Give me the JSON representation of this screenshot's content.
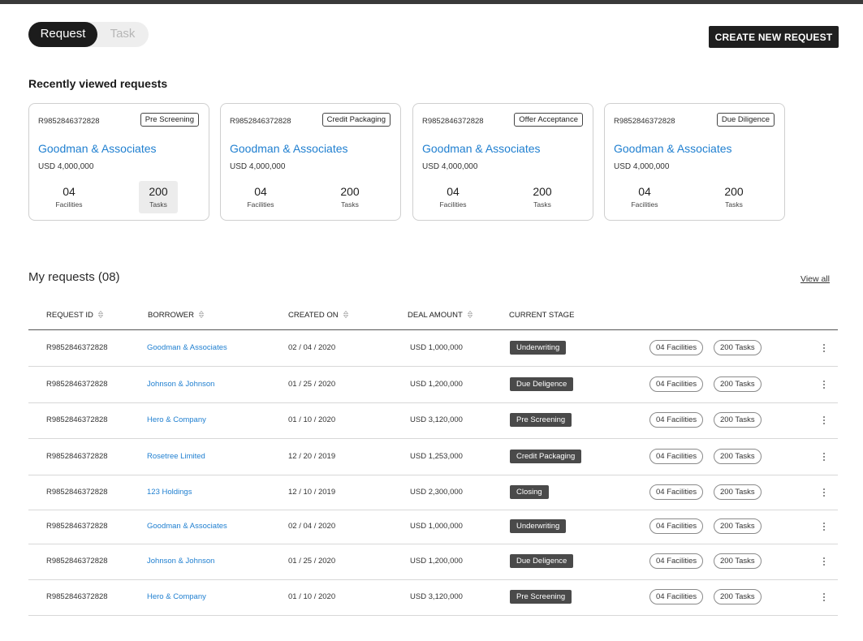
{
  "toggle": {
    "active": "Request",
    "inactive": "Task"
  },
  "create_button": "CREATE NEW REQUEST",
  "recent": {
    "title": "Recently viewed  requests",
    "cards": [
      {
        "id": "R9852846372828",
        "stage": "Pre Screening",
        "name": "Goodman & Associates",
        "amount": "USD 4,000,000",
        "facilities": "04",
        "facilities_label": "Facilities",
        "tasks": "200",
        "tasks_label": "Tasks"
      },
      {
        "id": "R9852846372828",
        "stage": "Credit Packaging",
        "name": "Goodman & Associates",
        "amount": "USD 4,000,000",
        "facilities": "04",
        "facilities_label": "Facilities",
        "tasks": "200",
        "tasks_label": "Tasks"
      },
      {
        "id": "R9852846372828",
        "stage": "Offer Acceptance",
        "name": "Goodman & Associates",
        "amount": "USD 4,000,000",
        "facilities": "04",
        "facilities_label": "Facilities",
        "tasks": "200",
        "tasks_label": "Tasks"
      },
      {
        "id": "R9852846372828",
        "stage": "Due Diligence",
        "name": "Goodman & Associates",
        "amount": "USD 4,000,000",
        "facilities": "04",
        "facilities_label": "Facilities",
        "tasks": "200",
        "tasks_label": "Tasks"
      }
    ]
  },
  "my_requests": {
    "title": "My requests (08)",
    "view_all": "View all",
    "columns": [
      "REQUEST ID",
      "BORROWER",
      "CREATED ON",
      "DEAL AMOUNT",
      "CURRENT STAGE"
    ],
    "rows": [
      {
        "id": "R9852846372828",
        "borrower": "Goodman & Associates",
        "created": "02 / 04 / 2020",
        "amount": "USD 1,000,000",
        "stage": "Underwriting",
        "facilities": "04 Facilities",
        "tasks": "200 Tasks"
      },
      {
        "id": "R9852846372828",
        "borrower": "Johnson & Johnson",
        "created": "01 / 25 / 2020",
        "amount": "USD 1,200,000",
        "stage": "Due Deligence",
        "facilities": "04 Facilities",
        "tasks": "200 Tasks"
      },
      {
        "id": "R9852846372828",
        "borrower": "Hero & Company",
        "created": "01 / 10 / 2020",
        "amount": "USD 3,120,000",
        "stage": "Pre Screening",
        "facilities": "04 Facilities",
        "tasks": "200 Tasks"
      },
      {
        "id": "R9852846372828",
        "borrower": "Rosetree Limited",
        "created": "12 / 20 / 2019",
        "amount": "USD 1,253,000",
        "stage": "Credit Packaging",
        "facilities": "04 Facilities",
        "tasks": "200 Tasks"
      },
      {
        "id": "R9852846372828",
        "borrower": "123 Holdings",
        "created": "12 / 10 / 2019",
        "amount": "USD 2,300,000",
        "stage": "Closing",
        "facilities": "04 Facilities",
        "tasks": "200 Tasks"
      },
      {
        "id": "R9852846372828",
        "borrower": "Goodman & Associates",
        "created": "02 / 04 / 2020",
        "amount": "USD 1,000,000",
        "stage": "Underwriting",
        "facilities": "04 Facilities",
        "tasks": "200 Tasks"
      },
      {
        "id": "R9852846372828",
        "borrower": "Johnson & Johnson",
        "created": "01 / 25 / 2020",
        "amount": "USD 1,200,000",
        "stage": "Due Deligence",
        "facilities": "04 Facilities",
        "tasks": "200 Tasks"
      },
      {
        "id": "R9852846372828",
        "borrower": "Hero & Company",
        "created": "01 / 10 / 2020",
        "amount": "USD 3,120,000",
        "stage": "Pre Screening",
        "facilities": "04 Facilities",
        "tasks": "200 Tasks"
      }
    ]
  },
  "icons": {
    "sort": "sort-icon",
    "more": "kebab-menu-icon"
  },
  "colors": {
    "link": "#1f7fd0",
    "stage_badge": "#4a4a4a",
    "primary_button": "#1f1f1f"
  }
}
